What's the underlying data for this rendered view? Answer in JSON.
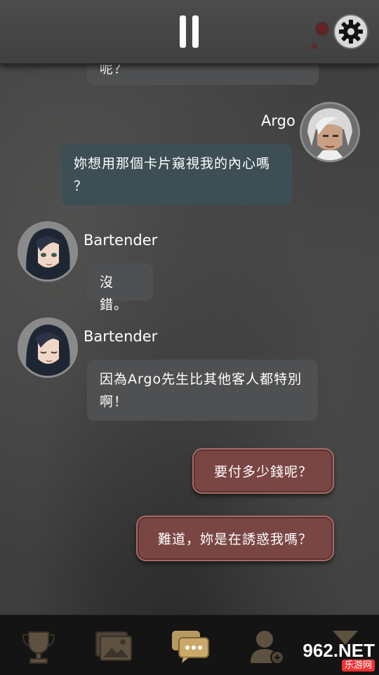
{
  "topbar": {
    "pause_icon": "pause-icon",
    "settings_icon": "gear-icon"
  },
  "messages": [
    {
      "speaker": "",
      "text": "呢？",
      "style": "gray"
    },
    {
      "speaker": "Argo",
      "line1": "妳想用那個卡片窺視我的內心嗎",
      "line2": "？",
      "style": "blue"
    },
    {
      "speaker": "Bartender",
      "text": "沒錯。",
      "style": "gray"
    },
    {
      "speaker": "Bartender",
      "line1": "因為Argo先生比其他客人都特別",
      "line2": "啊！",
      "style": "gray"
    }
  ],
  "choices": [
    {
      "label": "要付多少錢呢？"
    },
    {
      "label": "難道，妳是在誘惑我嗎？"
    }
  ],
  "bottom_nav": [
    {
      "icon": "trophy-icon"
    },
    {
      "icon": "gallery-icon"
    },
    {
      "icon": "chat-icon"
    },
    {
      "icon": "profile-icon"
    },
    {
      "icon": "hourglass-icon"
    }
  ],
  "watermark": {
    "brand": "962.NET",
    "sub": "乐游网"
  },
  "colors": {
    "choice_bg": "#7a4644",
    "player_bubble": "#3d4e55",
    "npc_bubble": "#4f5052"
  }
}
